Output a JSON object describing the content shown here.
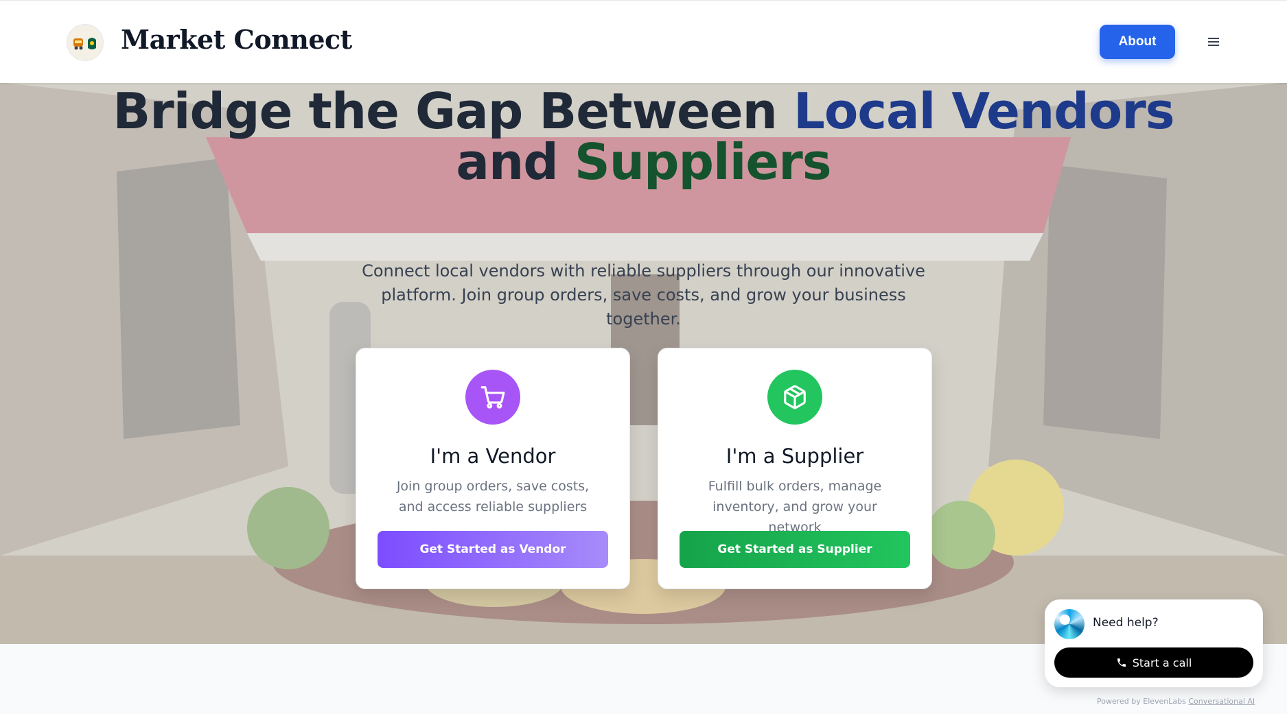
{
  "header": {
    "brand": "Market Connect",
    "about_label": "About",
    "logo_icon": "market-cart-logo",
    "menu_icon": "hamburger-menu-icon"
  },
  "hero": {
    "headline_part1": "Bridge the Gap Between ",
    "headline_highlight1": "Local Vendors",
    "headline_part2": "and ",
    "headline_highlight2": "Suppliers",
    "subtext": "Connect local vendors with reliable suppliers through our innovative platform. Join group orders, save costs, and grow your business together."
  },
  "cards": {
    "vendor": {
      "title": "I'm a Vendor",
      "description": "Join group orders, save costs, and access reliable suppliers",
      "button": "Get Started as Vendor",
      "icon": "shopping-cart-icon",
      "color": "#a855f7"
    },
    "supplier": {
      "title": "I'm a Supplier",
      "description": "Fulfill bulk orders, manage inventory, and grow your network",
      "button": "Get Started as Supplier",
      "icon": "package-icon",
      "color": "#22c55e"
    }
  },
  "widget": {
    "title": "Need help?",
    "call_label": "Start a call",
    "powered_prefix": "Powered by ElevenLabs ",
    "powered_link": "Conversational AI"
  },
  "colors": {
    "accent_blue": "#2563eb",
    "headline_blue": "#1e3a8a",
    "headline_green": "#14532d"
  }
}
